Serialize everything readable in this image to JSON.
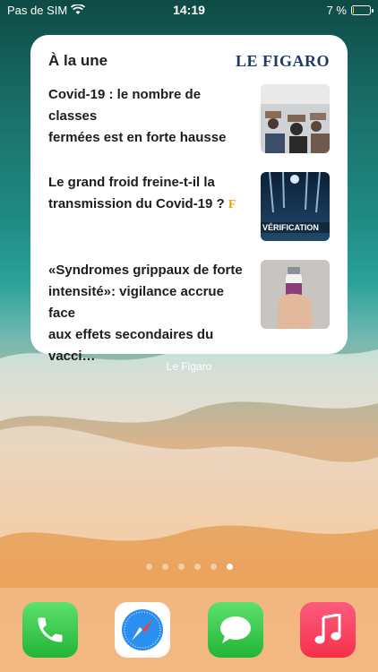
{
  "status_bar": {
    "carrier": "Pas de SIM",
    "time": "14:19",
    "battery_text": "7 %",
    "battery_level": 0.07
  },
  "widget": {
    "title": "À la une",
    "brand_logo_text": "LE FIGARO",
    "articles": [
      {
        "headline": "Covid-19 : le nombre de classes\nfermées est en forte hausse"
      },
      {
        "headline": "Le grand froid freine-t-il la\ntransmission du Covid-19 ?",
        "badge_icon": "figaro-premium-icon"
      },
      {
        "headline": "«Syndromes grippaux de forte\nintensité»: vigilance accrue face\naux effets secondaires du vacci…"
      }
    ],
    "thumb2_overlay": "VÉRIFICATION",
    "app_label": "Le Figaro"
  },
  "page_dots": {
    "count": 6,
    "active_index": 5
  },
  "dock": {
    "apps": [
      "phone-icon",
      "safari-icon",
      "messages-icon",
      "music-icon"
    ]
  },
  "colors": {
    "brand": "#1e3a6b",
    "phone": "#31c94b",
    "messages": "#31c94b",
    "music": "#fa3c57"
  }
}
